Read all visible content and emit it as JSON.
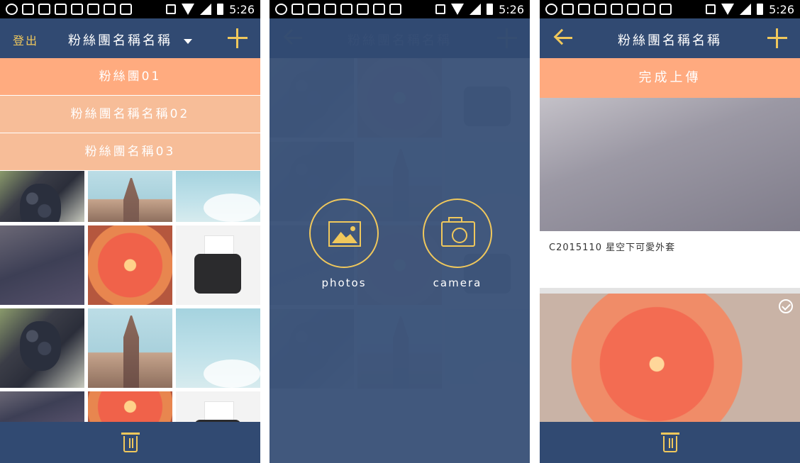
{
  "status_bar": {
    "time": "5:26"
  },
  "colors": {
    "navy": "#314a72",
    "accent": "#f0c85c",
    "salmon": "#ffaa7f"
  },
  "screen1": {
    "header": {
      "logout_label": "登出",
      "title": "粉絲團名稱名稱",
      "add_icon": "plus-icon",
      "dropdown_icon": "caret-down-icon"
    },
    "dropdown_items": [
      "粉絲團01",
      "粉絲團名稱名稱02",
      "粉絲團名稱03"
    ],
    "tiles": [
      "grapes",
      "city",
      "sky",
      "night",
      "flower",
      "typewriter",
      "grapes",
      "city",
      "sky",
      "night",
      "flower",
      "typewriter"
    ],
    "bottom_icon": "trash-icon"
  },
  "screen2": {
    "options": [
      {
        "label": "photos",
        "icon": "image-icon"
      },
      {
        "label": "camera",
        "icon": "camera-icon"
      }
    ]
  },
  "screen3": {
    "header": {
      "title": "粉絲團名稱名稱",
      "back_icon": "back-arrow-icon",
      "add_icon": "plus-icon"
    },
    "upload_label": "完成上傳",
    "photos": [
      {
        "caption": "C2015110 星空下可愛外套"
      },
      {
        "selected": true
      }
    ],
    "bottom_icon": "trash-icon"
  }
}
